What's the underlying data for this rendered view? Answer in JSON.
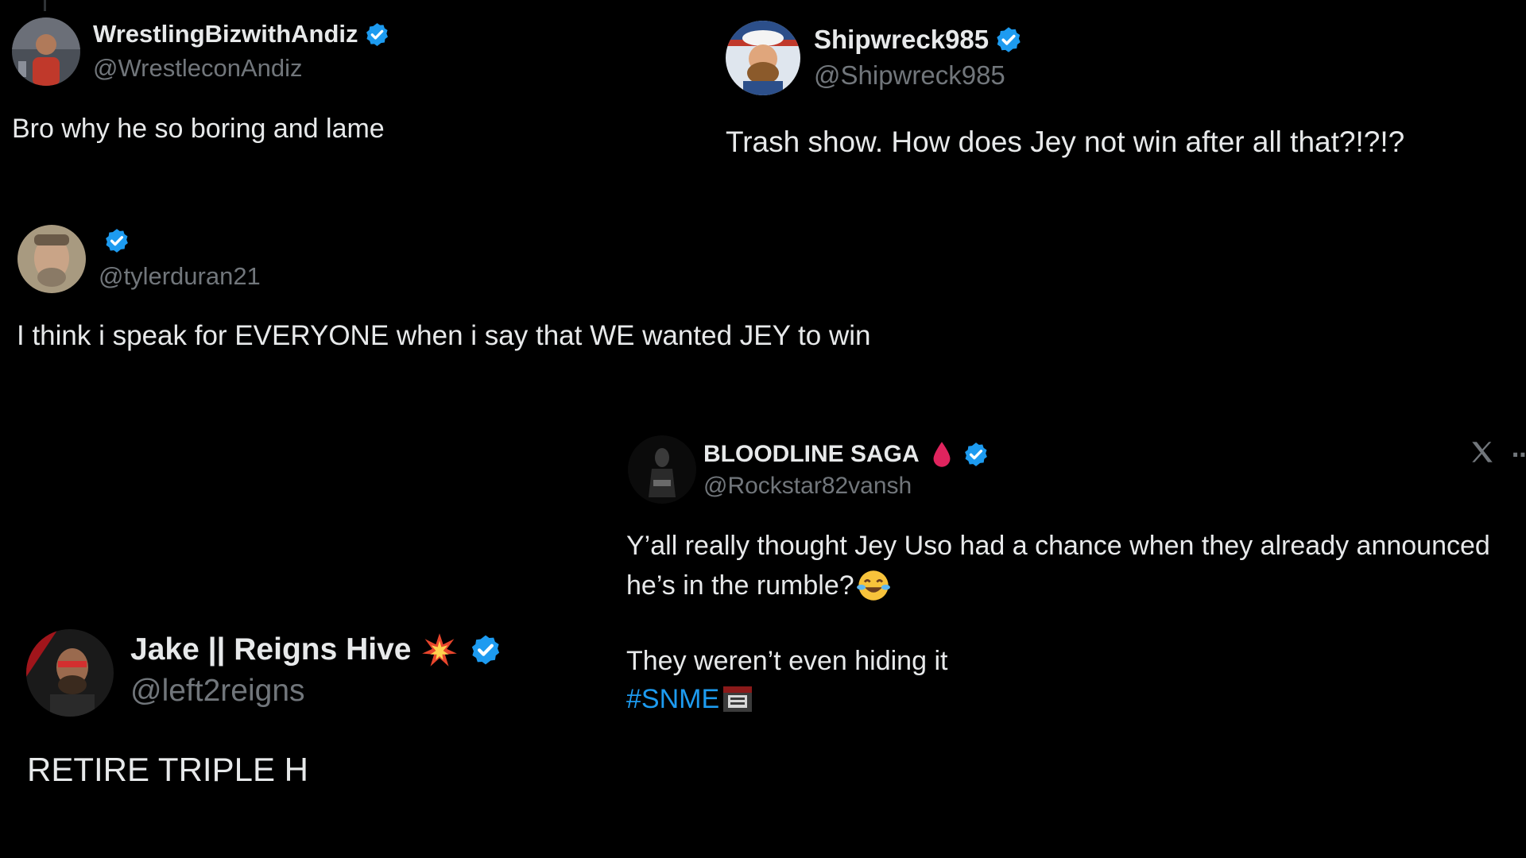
{
  "colors": {
    "background": "#000000",
    "text": "#e7e9ea",
    "handle": "#71767b",
    "verified": "#1d9bf0",
    "hashtag": "#1d9bf0"
  },
  "tweets": [
    {
      "display_name": "WrestlingBizwithAndiz",
      "handle": "@WrestleconAndiz",
      "text": "Bro why he so boring and lame",
      "verified": true
    },
    {
      "display_name": "Shipwreck985",
      "handle": "@Shipwreck985",
      "text": "Trash show. How does Jey not win after all that?!?!?",
      "verified": true
    },
    {
      "display_name": "",
      "handle": "@tylerduran21",
      "text": "I think i speak for EVERYONE when i say that WE wanted JEY to win",
      "verified": true
    },
    {
      "display_name": "BLOODLINE SAGA",
      "name_emoji": "drop-of-blood-icon",
      "handle": "@Rockstar82vansh",
      "line1": "Y’all really thought Jey Uso had a chance when they already announced",
      "line2": "he’s in the rumble?",
      "line2_emoji": "face-with-tears-of-joy-icon",
      "line3": "They weren’t even hiding it",
      "hashtag": "#SNME",
      "hashtag_emoji": "snme-logo-icon",
      "verified": true
    },
    {
      "display_name": "Jake || Reigns Hive",
      "name_emoji": "collision-icon",
      "handle": "@left2reigns",
      "text": "RETIRE TRIPLE H",
      "verified": true
    }
  ],
  "icons": {
    "verified": "verified-badge-icon",
    "x_logo": "x-logo-icon",
    "more": "more-options-icon"
  }
}
